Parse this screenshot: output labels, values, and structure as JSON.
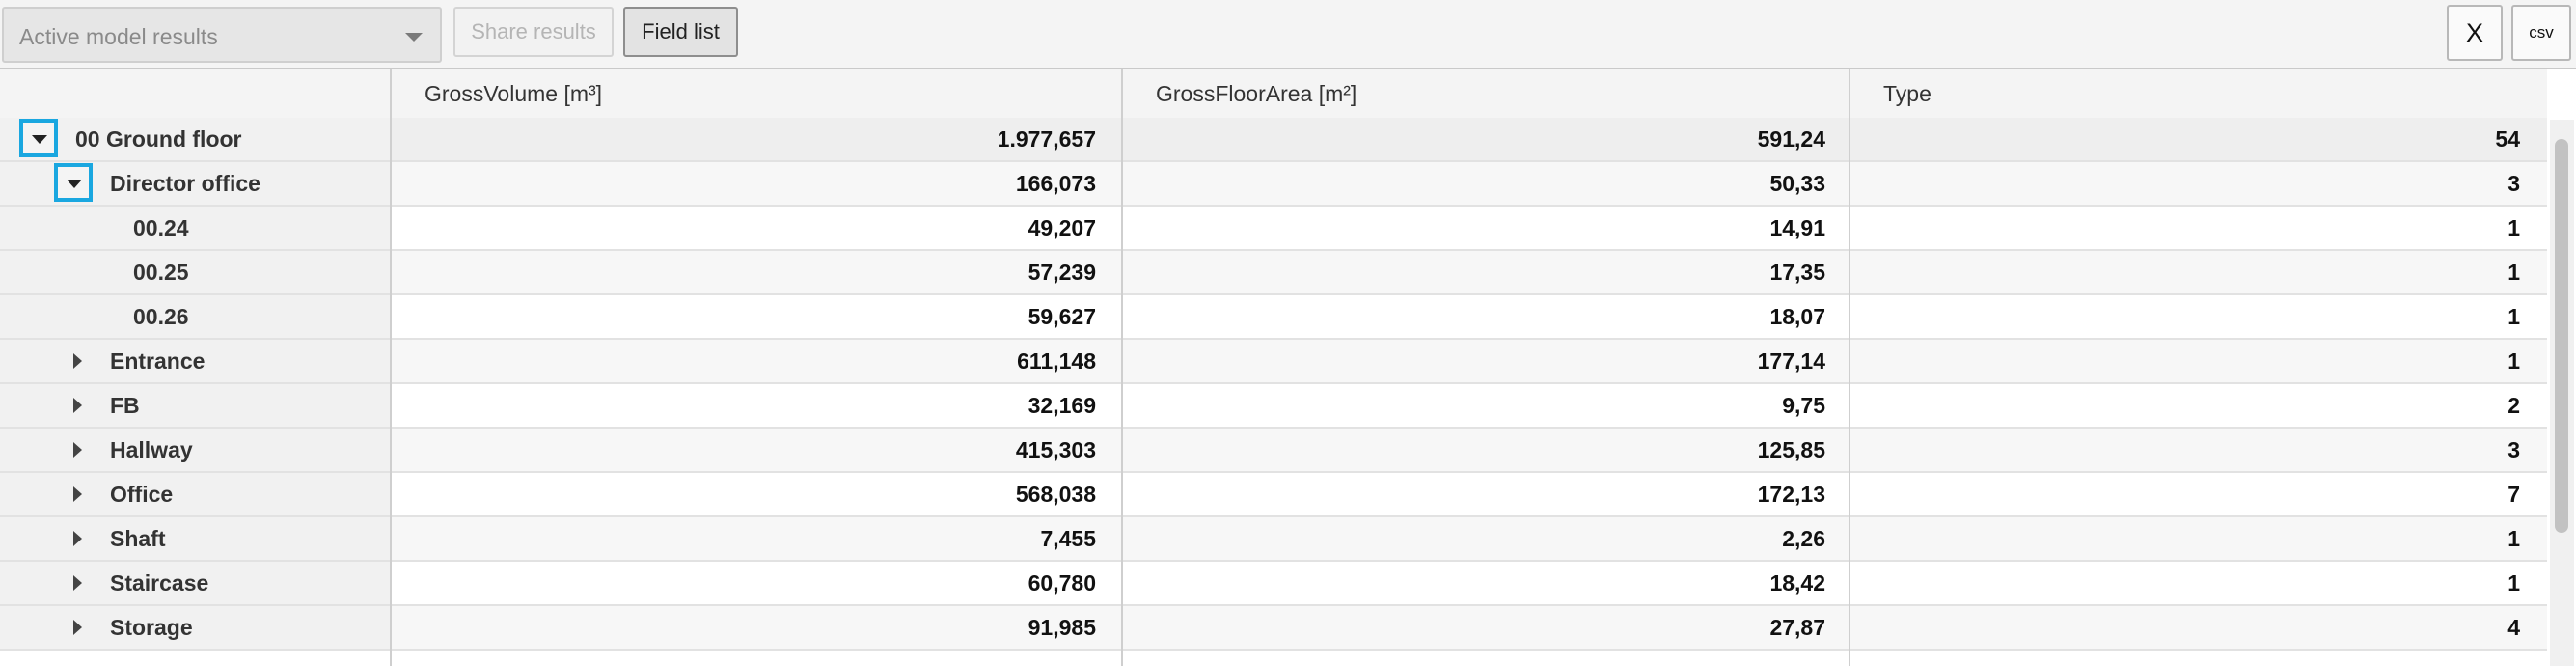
{
  "toolbar": {
    "dropdown_value": "Active model results",
    "share_label": "Share results",
    "field_list_label": "Field list",
    "close_label": "X",
    "csv_label": "csv"
  },
  "columns": [
    "GrossVolume [m³]",
    "GrossFloorArea [m²]",
    "Type"
  ],
  "rows": [
    {
      "label": "00 Ground floor",
      "level": 0,
      "toggle": "expanded",
      "values": [
        "1.977,657",
        "591,24",
        "54"
      ]
    },
    {
      "label": "Director office",
      "level": 1,
      "toggle": "expanded",
      "values": [
        "166,073",
        "50,33",
        "3"
      ]
    },
    {
      "label": "00.24",
      "level": 2,
      "toggle": "none",
      "values": [
        "49,207",
        "14,91",
        "1"
      ]
    },
    {
      "label": "00.25",
      "level": 2,
      "toggle": "none",
      "values": [
        "57,239",
        "17,35",
        "1"
      ]
    },
    {
      "label": "00.26",
      "level": 2,
      "toggle": "none",
      "values": [
        "59,627",
        "18,07",
        "1"
      ]
    },
    {
      "label": "Entrance",
      "level": 1,
      "toggle": "collapsed",
      "values": [
        "611,148",
        "177,14",
        "1"
      ]
    },
    {
      "label": "FB",
      "level": 1,
      "toggle": "collapsed",
      "values": [
        "32,169",
        "9,75",
        "2"
      ]
    },
    {
      "label": "Hallway",
      "level": 1,
      "toggle": "collapsed",
      "values": [
        "415,303",
        "125,85",
        "3"
      ]
    },
    {
      "label": "Office",
      "level": 1,
      "toggle": "collapsed",
      "values": [
        "568,038",
        "172,13",
        "7"
      ]
    },
    {
      "label": "Shaft",
      "level": 1,
      "toggle": "collapsed",
      "values": [
        "7,455",
        "2,26",
        "1"
      ]
    },
    {
      "label": "Staircase",
      "level": 1,
      "toggle": "collapsed",
      "values": [
        "60,780",
        "18,42",
        "1"
      ]
    },
    {
      "label": "Storage",
      "level": 1,
      "toggle": "collapsed",
      "values": [
        "91,985",
        "27,87",
        "4"
      ]
    }
  ],
  "icons": {
    "expanded": "caret-down-icon",
    "collapsed": "caret-right-icon"
  },
  "colors": {
    "accent": "#1aa7e0"
  }
}
